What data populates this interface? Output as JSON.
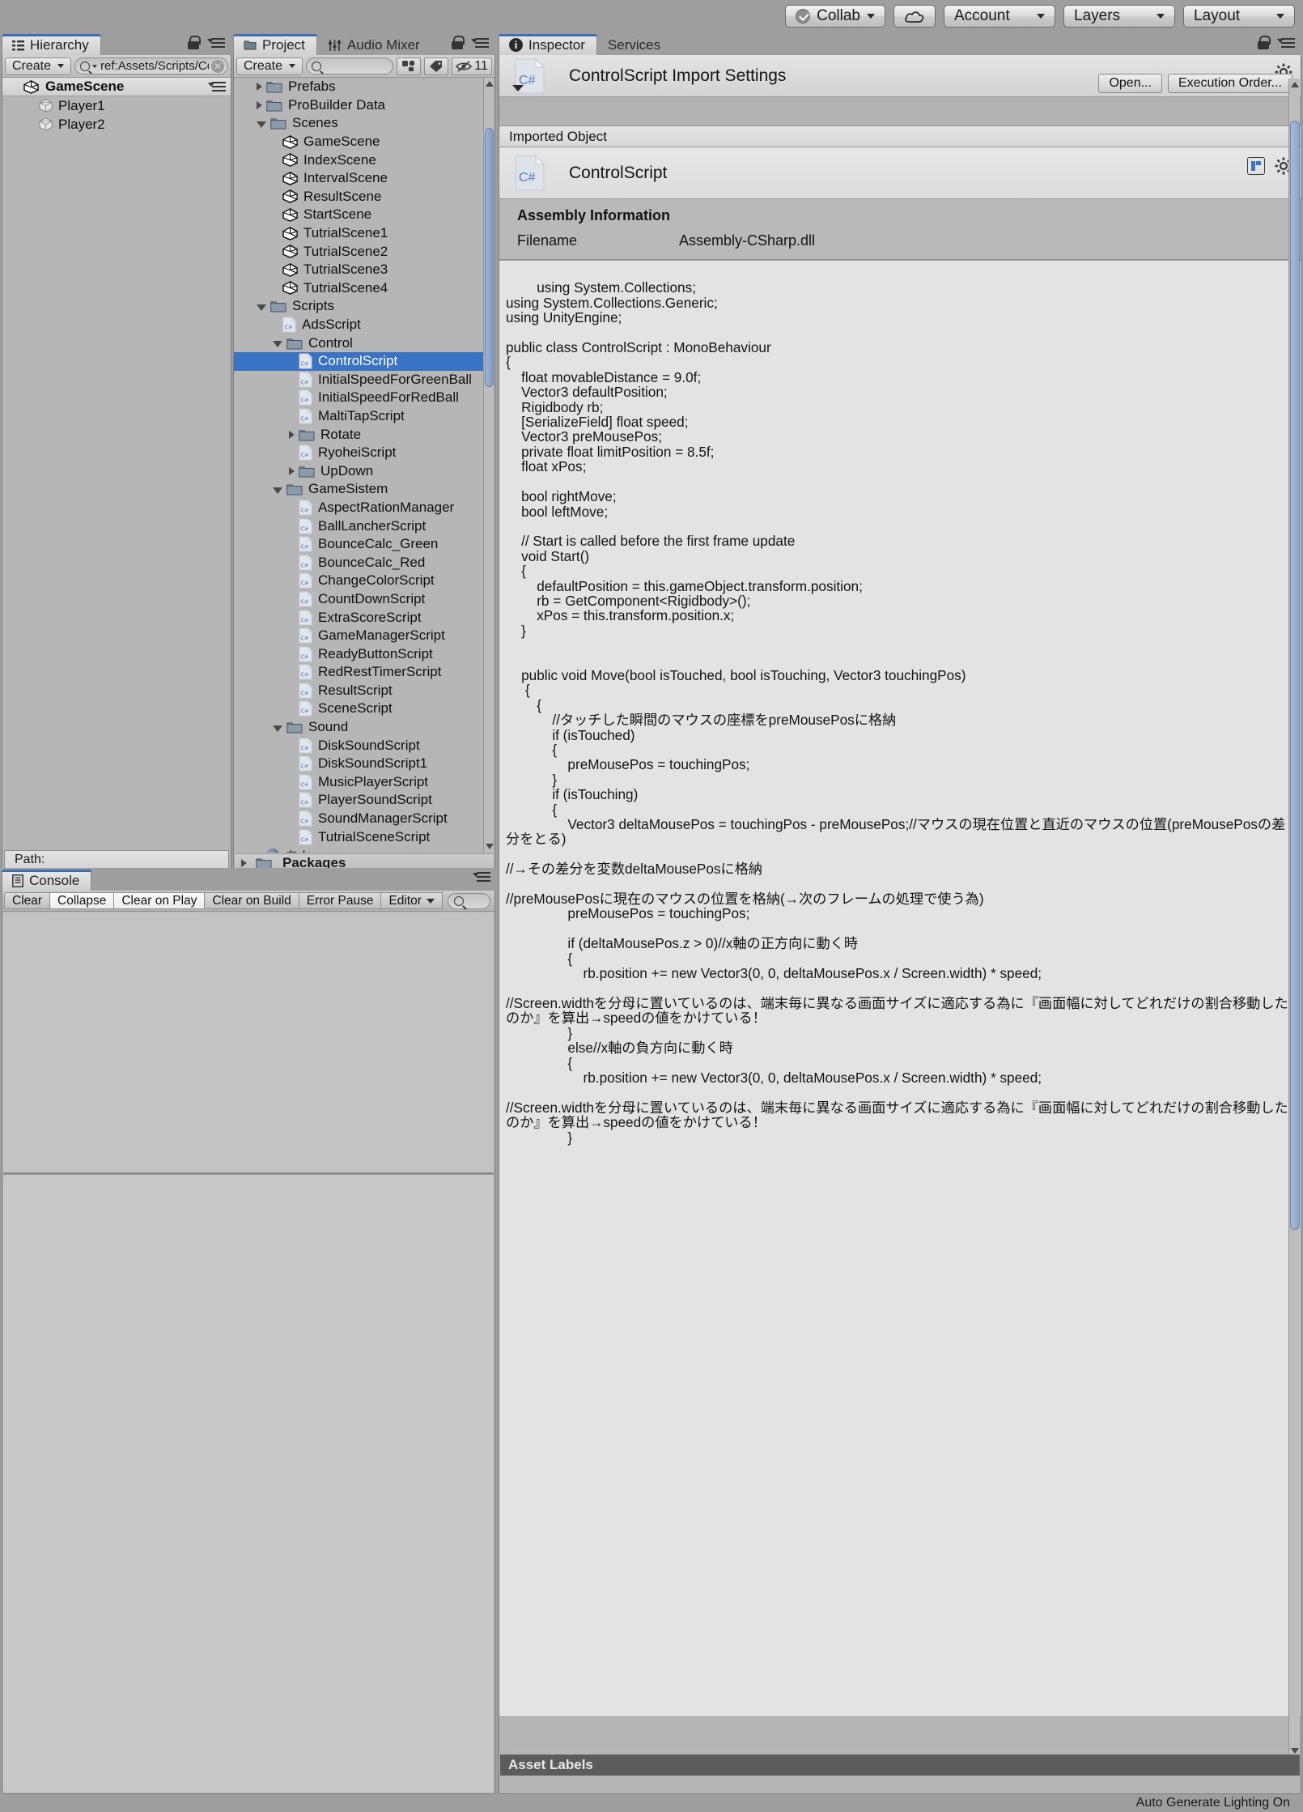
{
  "toolbar": {
    "collab": "Collab",
    "cloud_icon": "cloud-icon",
    "account": "Account",
    "layers": "Layers",
    "layout": "Layout"
  },
  "hierarchy": {
    "tab": "Hierarchy",
    "create": "Create",
    "search_value": "ref:Assets/Scripts/Contro",
    "scene": "GameScene",
    "objects": [
      {
        "label": "Player1"
      },
      {
        "label": "Player2"
      }
    ],
    "path_label": "Path:"
  },
  "project": {
    "tab": "Project",
    "tab2": "Audio Mixer",
    "create": "Create",
    "search_placeholder": "",
    "visible_count": "11",
    "tree": [
      {
        "label": "Prefabs",
        "indent": 1,
        "icon": "folder",
        "tri": "closed"
      },
      {
        "label": "ProBuilder Data",
        "indent": 1,
        "icon": "folder",
        "tri": "closed"
      },
      {
        "label": "Scenes",
        "indent": 1,
        "icon": "folder",
        "tri": "open"
      },
      {
        "label": "GameScene",
        "indent": 2,
        "icon": "unity",
        "tri": "none"
      },
      {
        "label": "IndexScene",
        "indent": 2,
        "icon": "unity",
        "tri": "none"
      },
      {
        "label": "IntervalScene",
        "indent": 2,
        "icon": "unity",
        "tri": "none"
      },
      {
        "label": "ResultScene",
        "indent": 2,
        "icon": "unity",
        "tri": "none"
      },
      {
        "label": "StartScene",
        "indent": 2,
        "icon": "unity",
        "tri": "none"
      },
      {
        "label": "TutrialScene1",
        "indent": 2,
        "icon": "unity",
        "tri": "none"
      },
      {
        "label": "TutrialScene2",
        "indent": 2,
        "icon": "unity",
        "tri": "none"
      },
      {
        "label": "TutrialScene3",
        "indent": 2,
        "icon": "unity",
        "tri": "none"
      },
      {
        "label": "TutrialScene4",
        "indent": 2,
        "icon": "unity",
        "tri": "none"
      },
      {
        "label": "Scripts",
        "indent": 1,
        "icon": "folder",
        "tri": "open"
      },
      {
        "label": "AdsScript",
        "indent": 2,
        "icon": "cs",
        "tri": "none"
      },
      {
        "label": "Control",
        "indent": 2,
        "icon": "folder",
        "tri": "open"
      },
      {
        "label": "ControlScript",
        "indent": 3,
        "icon": "cs",
        "tri": "none",
        "selected": true
      },
      {
        "label": "InitialSpeedForGreenBall",
        "indent": 3,
        "icon": "cs",
        "tri": "none"
      },
      {
        "label": "InitialSpeedForRedBall",
        "indent": 3,
        "icon": "cs",
        "tri": "none"
      },
      {
        "label": "MaltiTapScript",
        "indent": 3,
        "icon": "cs",
        "tri": "none"
      },
      {
        "label": "Rotate",
        "indent": 3,
        "icon": "folder",
        "tri": "closed"
      },
      {
        "label": "RyoheiScript",
        "indent": 3,
        "icon": "cs",
        "tri": "none"
      },
      {
        "label": "UpDown",
        "indent": 3,
        "icon": "folder",
        "tri": "closed"
      },
      {
        "label": "GameSistem",
        "indent": 2,
        "icon": "folder",
        "tri": "open"
      },
      {
        "label": "AspectRationManager",
        "indent": 3,
        "icon": "cs",
        "tri": "none"
      },
      {
        "label": "BallLancherScript",
        "indent": 3,
        "icon": "cs",
        "tri": "none"
      },
      {
        "label": "BounceCalc_Green",
        "indent": 3,
        "icon": "cs",
        "tri": "none"
      },
      {
        "label": "BounceCalc_Red",
        "indent": 3,
        "icon": "cs",
        "tri": "none"
      },
      {
        "label": "ChangeColorScript",
        "indent": 3,
        "icon": "cs",
        "tri": "none"
      },
      {
        "label": "CountDownScript",
        "indent": 3,
        "icon": "cs",
        "tri": "none"
      },
      {
        "label": "ExtraScoreScript",
        "indent": 3,
        "icon": "cs",
        "tri": "none"
      },
      {
        "label": "GameManagerScript",
        "indent": 3,
        "icon": "cs",
        "tri": "none"
      },
      {
        "label": "ReadyButtonScript",
        "indent": 3,
        "icon": "cs",
        "tri": "none"
      },
      {
        "label": "RedRestTimerScript",
        "indent": 3,
        "icon": "cs",
        "tri": "none"
      },
      {
        "label": "ResultScript",
        "indent": 3,
        "icon": "cs",
        "tri": "none"
      },
      {
        "label": "SceneScript",
        "indent": 3,
        "icon": "cs",
        "tri": "none"
      },
      {
        "label": "Sound",
        "indent": 2,
        "icon": "folder",
        "tri": "open"
      },
      {
        "label": "DiskSoundScript",
        "indent": 3,
        "icon": "cs",
        "tri": "none"
      },
      {
        "label": "DiskSoundScript1",
        "indent": 3,
        "icon": "cs",
        "tri": "none"
      },
      {
        "label": "MusicPlayerScript",
        "indent": 3,
        "icon": "cs",
        "tri": "none"
      },
      {
        "label": "PlayerSoundScript",
        "indent": 3,
        "icon": "cs",
        "tri": "none"
      },
      {
        "label": "SoundManagerScript",
        "indent": 3,
        "icon": "cs",
        "tri": "none"
      },
      {
        "label": "TutrialSceneScript",
        "indent": 3,
        "icon": "cs",
        "tri": "none"
      },
      {
        "label": "あか",
        "indent": 1,
        "icon": "ball",
        "tri": "none"
      },
      {
        "label": "Packages",
        "indent": 0,
        "icon": "folder",
        "tri": "closed",
        "bold": true
      }
    ]
  },
  "console": {
    "tab": "Console",
    "clear": "Clear",
    "collapse": "Collapse",
    "clear_on_play": "Clear on Play",
    "clear_on_build": "Clear on Build",
    "error_pause": "Error Pause",
    "editor": "Editor"
  },
  "inspector": {
    "tab": "Inspector",
    "tab2": "Services",
    "title": "ControlScript Import Settings",
    "open_button": "Open...",
    "execution_order_button": "Execution Order...",
    "imported_object_header": "Imported Object",
    "imported_object_name": "ControlScript",
    "assembly_title": "Assembly Information",
    "filename_key": "Filename",
    "filename_value": "Assembly-CSharp.dll",
    "asset_labels": "Asset Labels",
    "code": "using System.Collections;\nusing System.Collections.Generic;\nusing UnityEngine;\n\npublic class ControlScript : MonoBehaviour\n{\n    float movableDistance = 9.0f;\n    Vector3 defaultPosition;\n    Rigidbody rb;\n    [SerializeField] float speed;\n    Vector3 preMousePos;\n    private float limitPosition = 8.5f;\n    float xPos;\n\n    bool rightMove;\n    bool leftMove;\n\n    // Start is called before the first frame update\n    void Start()\n    {\n        defaultPosition = this.gameObject.transform.position;\n        rb = GetComponent<Rigidbody>();\n        xPos = this.transform.position.x;\n    }\n\n\n    public void Move(bool isTouched, bool isTouching, Vector3 touchingPos)\n     {\n        {\n            //タッチした瞬間のマウスの座標をpreMousePosに格納\n            if (isTouched)\n            {\n                preMousePos = touchingPos;\n            }\n            if (isTouching)\n            {\n                Vector3 deltaMousePos = touchingPos - preMousePos;//マウスの現在位置と直近のマウスの位置(preMousePosの差分をとる)\n\n//→その差分を変数deltaMousePosに格納\n\n//preMousePosに現在のマウスの位置を格納(→次のフレームの処理で使う為)\n                preMousePos = touchingPos;\n\n                if (deltaMousePos.z > 0)//x軸の正方向に動く時\n                {\n                    rb.position += new Vector3(0, 0, deltaMousePos.x / Screen.width) * speed;\n\n//Screen.widthを分母に置いているのは、端末毎に異なる画面サイズに適応する為に『画面幅に対してどれだけの割合移動したのか』を算出→speedの値をかけている！\n                }\n                else//x軸の負方向に動く時\n                {\n                    rb.position += new Vector3(0, 0, deltaMousePos.x / Screen.width) * speed;\n\n//Screen.widthを分母に置いているのは、端末毎に異なる画面サイズに適応する為に『画面幅に対してどれだけの割合移動したのか』を算出→speedの値をかけている！\n                }"
  },
  "status": {
    "lighting": "Auto Generate Lighting On"
  }
}
